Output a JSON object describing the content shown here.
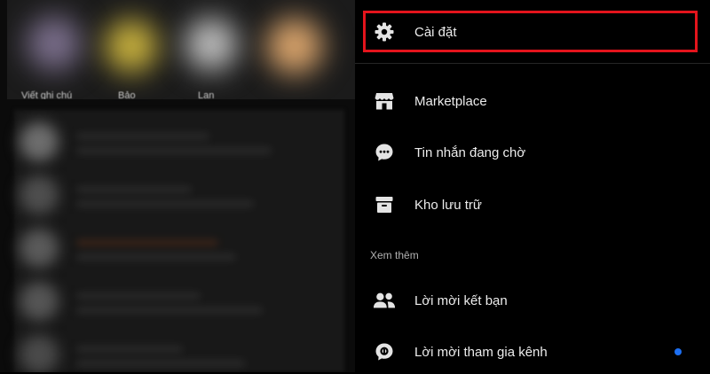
{
  "colors": {
    "background": "#000000",
    "text": "#ececec",
    "icon": "#e4e4e4",
    "highlight_border": "#e3141c",
    "unread_dot": "#1d6ff2"
  },
  "stories": {
    "labels": [
      "Viết ghi chú",
      "Bảo",
      "Lan"
    ]
  },
  "menu": {
    "items": [
      {
        "label": "Cài đặt",
        "icon": "gear-icon"
      },
      {
        "label": "Marketplace",
        "icon": "storefront-icon"
      },
      {
        "label": "Tin nhắn đang chờ",
        "icon": "chat-bubble-icon"
      },
      {
        "label": "Kho lưu trữ",
        "icon": "archive-box-icon"
      }
    ],
    "section_label": "Xem thêm",
    "more_items": [
      {
        "label": "Lời mời kết bạn",
        "icon": "friends-icon"
      },
      {
        "label": "Lời mời tham gia kênh",
        "icon": "channel-invite-icon"
      }
    ]
  }
}
